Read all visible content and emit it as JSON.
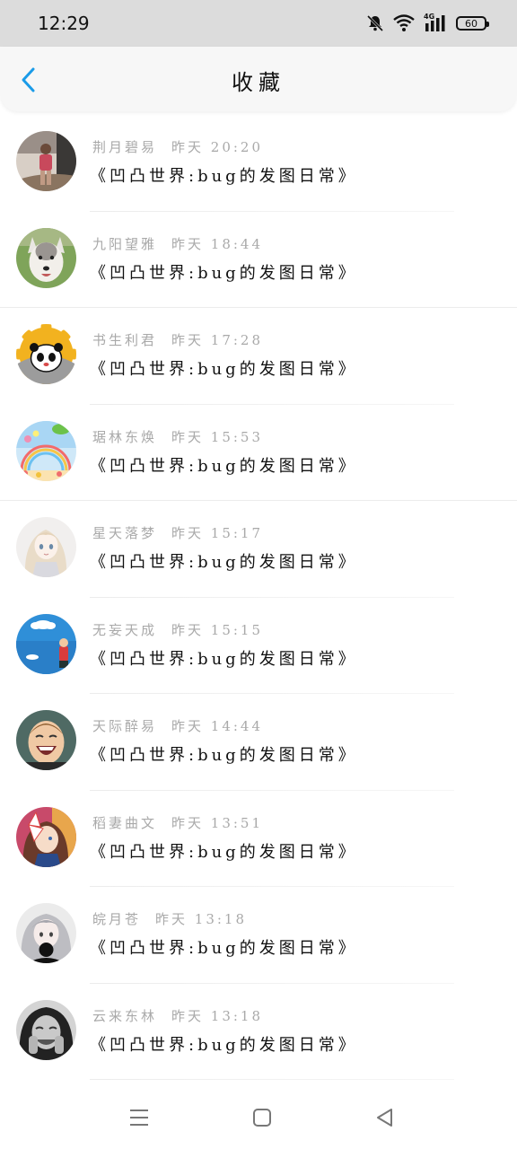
{
  "status_bar": {
    "time": "12:29",
    "network": "4G",
    "battery": "60",
    "icons": [
      "bell-muted-icon",
      "wifi-icon",
      "signal-icon",
      "battery-icon"
    ]
  },
  "header": {
    "title": "收藏",
    "back_icon": "chevron-left-icon",
    "accent_color": "#1a9be8"
  },
  "favorites": [
    {
      "name": "荆月碧易",
      "time": "昨天 20:20",
      "title": "《凹凸世界:bug的发图日常》",
      "avatar": "girl-walking-photo"
    },
    {
      "name": "九阳望雅",
      "time": "昨天 18:44",
      "title": "《凹凸世界:bug的发图日常》",
      "avatar": "husky-dog-photo"
    },
    {
      "name": "书生利君",
      "time": "昨天 17:28",
      "title": "《凹凸世界:bug的发图日常》",
      "avatar": "panda-cartoon"
    },
    {
      "name": "琚林东焕",
      "time": "昨天 15:53",
      "title": "《凹凸世界:bug的发图日常》",
      "avatar": "rainbow-balloon-illustration"
    },
    {
      "name": "星天落梦",
      "time": "昨天 15:17",
      "title": "《凹凸世界:bug的发图日常》",
      "avatar": "anime-girl-drawing"
    },
    {
      "name": "无妄天成",
      "time": "昨天 15:15",
      "title": "《凹凸世界:bug的发图日常》",
      "avatar": "blue-sky-cartoon"
    },
    {
      "name": "天际醉易",
      "time": "昨天 14:44",
      "title": "《凹凸世界:bug的发图日常》",
      "avatar": "laughing-boy-photo"
    },
    {
      "name": "稻妻曲文",
      "time": "昨天 13:51",
      "title": "《凹凸世界:bug的发图日常》",
      "avatar": "anime-fox-mask-girl"
    },
    {
      "name": "皖月苍",
      "time": "昨天 13:18",
      "title": "《凹凸世界:bug的发图日常》",
      "avatar": "anime-gray-hair-girl"
    },
    {
      "name": "云来东林",
      "time": "昨天 13:18",
      "title": "《凹凸世界:bug的发图日常》",
      "avatar": "woman-laughing-bw-photo"
    }
  ],
  "nav_bar": {
    "icons": [
      "menu-icon",
      "home-square-icon",
      "back-triangle-icon"
    ]
  }
}
